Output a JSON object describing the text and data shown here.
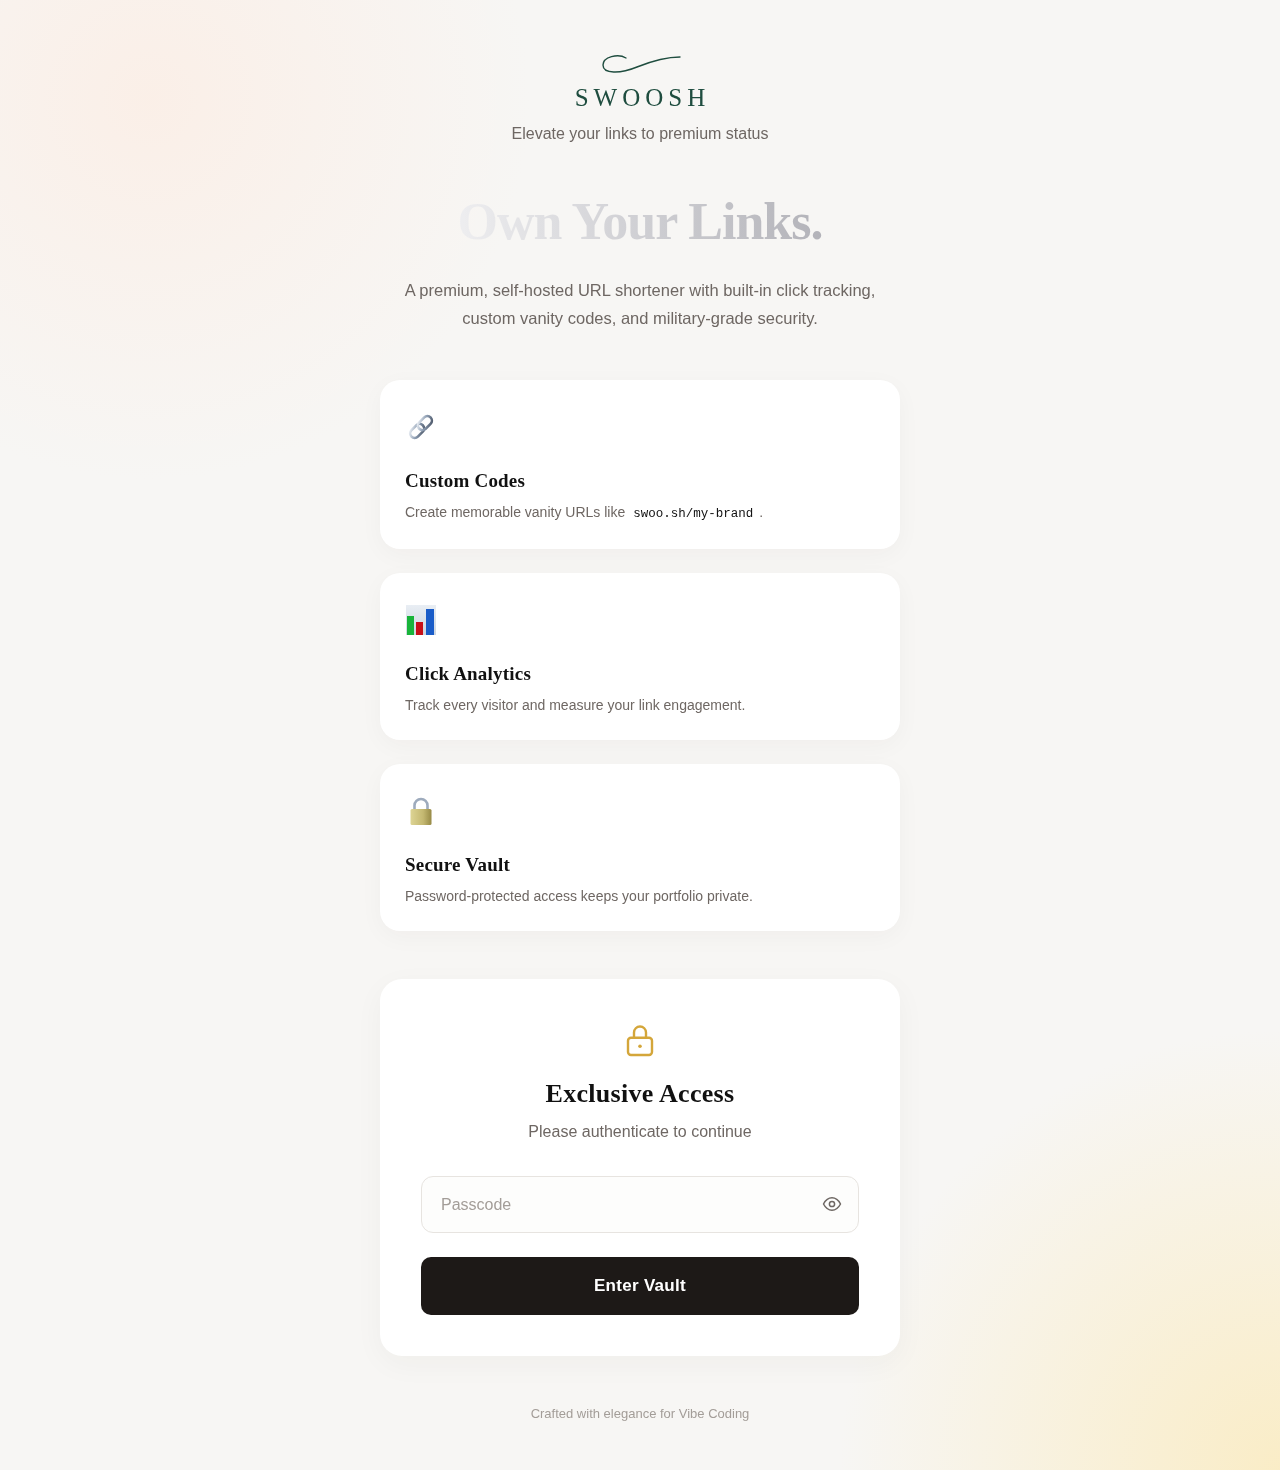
{
  "brand": {
    "name": "SWOOSH",
    "tagline": "Elevate your links to premium status"
  },
  "hero": {
    "headline": "Own Your Links.",
    "description": "A premium, self-hosted URL shortener with built-in click tracking, custom vanity codes, and military-grade security."
  },
  "features": [
    {
      "title": "Custom Codes",
      "description": [
        {
          "kind": "text",
          "text": "Create memorable vanity URLs like"
        },
        {
          "kind": "code",
          "text": "swoo.sh/my-brand"
        },
        {
          "kind": "text",
          "text": "."
        }
      ]
    },
    {
      "title": "Click Analytics",
      "description": [
        {
          "kind": "text",
          "text": "Track every visitor and measure your link engagement."
        }
      ]
    },
    {
      "title": "Secure Vault",
      "description": [
        {
          "kind": "text",
          "text": "Password-protected access keeps your portfolio private."
        }
      ]
    }
  ],
  "login": {
    "title": "Exclusive Access",
    "subtitle": "Please authenticate to continue",
    "passcode": {
      "placeholder": "Passcode"
    },
    "submit": "Enter Vault"
  },
  "footer": {
    "text": "Crafted with elegance for Vibe Coding"
  }
}
